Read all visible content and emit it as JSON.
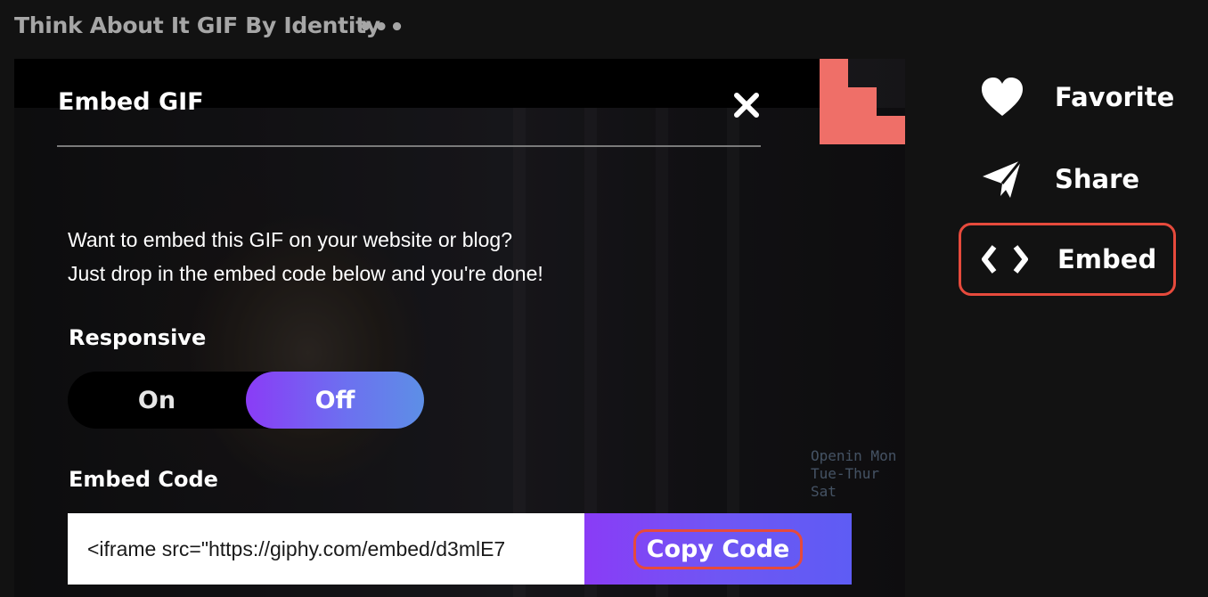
{
  "header": {
    "title": "Think About It GIF By Identity",
    "more_label": "•••"
  },
  "modal": {
    "title": "Embed GIF",
    "description_line1": "Want to embed this GIF on your website or blog?",
    "description_line2": "Just drop in the embed code below and you're done!",
    "responsive_label": "Responsive",
    "toggle": {
      "on_label": "On",
      "off_label": "Off",
      "selected": "Off"
    },
    "embed_code_label": "Embed Code",
    "embed_code_value": "<iframe src=\"https://giphy.com/embed/d3mlE7",
    "copy_button_label": "Copy Code"
  },
  "actions": [
    {
      "label": "Favorite",
      "icon": "heart-icon"
    },
    {
      "label": "Share",
      "icon": "paper-plane-icon"
    },
    {
      "label": "Embed",
      "icon": "code-brackets-icon"
    }
  ],
  "gif_overlay_text": "Openin Mon Tue-Thur Sat",
  "colors": {
    "background": "#121212",
    "accent_purple": "#8a3cf6",
    "accent_blue": "#5d8fe6",
    "highlight_red": "#e64a3c",
    "logo_pink": "#ef6f68"
  }
}
